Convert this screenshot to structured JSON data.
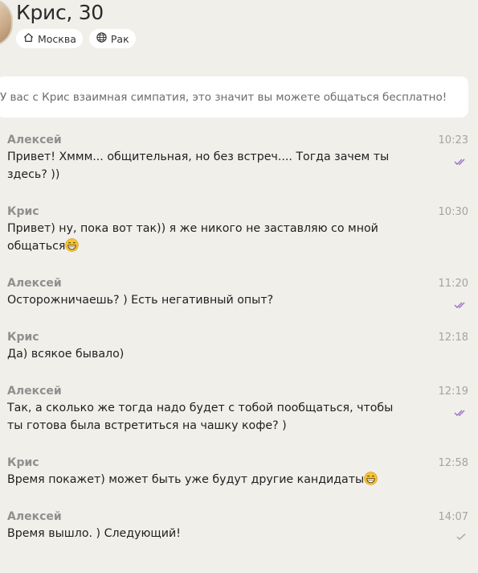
{
  "profile": {
    "title": "Крис, 30",
    "city_chip": {
      "icon": "home-icon",
      "label": "Москва"
    },
    "zodiac_chip": {
      "icon": "globe-icon",
      "label": "Рак"
    }
  },
  "notice": "У вас с Крис взаимная симпатия, это значит вы можете общаться бесплатно!",
  "colors": {
    "background": "#f0efea",
    "read_check": "#9b6fd0",
    "sent_check": "#a4a4a4"
  },
  "messages": [
    {
      "author": "Алексей",
      "time": "10:23",
      "text": "Привет! Хммм... общительная, но без встреч.... Тогда зачем ты здесь? ))",
      "status": "read"
    },
    {
      "author": "Крис",
      "time": "10:30",
      "text": "Привет) ну, пока вот так)) я же никого не заставляю со мной общаться",
      "emoji": "grinning-face-icon"
    },
    {
      "author": "Алексей",
      "time": "11:20",
      "text": "Осторожничаешь? ) Есть негативный опыт?",
      "status": "read"
    },
    {
      "author": "Крис",
      "time": "12:18",
      "text": "Да) всякое бывало)"
    },
    {
      "author": "Алексей",
      "time": "12:19",
      "text": "Так, а сколько же тогда надо будет с тобой пообщаться, чтобы ты готова была встретиться на чашку кофе? )",
      "status": "read"
    },
    {
      "author": "Крис",
      "time": "12:58",
      "text": "Время покажет) может быть уже будут другие кандидаты",
      "emoji": "grinning-face-icon"
    },
    {
      "author": "Алексей",
      "time": "14:07",
      "text": "Время вышло. ) Следующий!",
      "status": "sent"
    }
  ]
}
